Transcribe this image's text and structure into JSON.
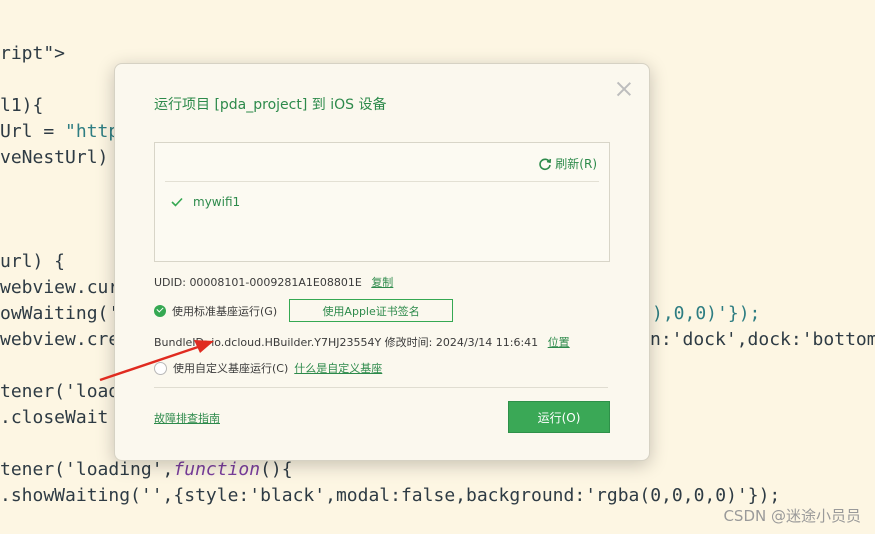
{
  "code": {
    "l1": "ript\">",
    "l2": "l1){",
    "l3a": "Url = ",
    "l3b": "\"http",
    "l4": "veNestUrl)",
    "l5": "url) {",
    "l6": "webview.cur",
    "l7a": "owWaiting('",
    "l7b": "),0,0)'});",
    "l8a": "webview.cre",
    "l8b": "n:'dock',dock:'bottom",
    "l9": "tener('load",
    "l10": ".closeWait",
    "l11a": "tener('loading',",
    "l11b": "function",
    "l11c": "(){",
    "l12": ".showWaiting('',{style:'black',modal:false,background:'rgba(0,0,0,0)'});"
  },
  "dialog": {
    "title": "运行项目 [pda_project] 到 iOS 设备",
    "refresh_label": "刷新(R)",
    "device_name": "mywifi1",
    "udid_label": "UDID: 00008101-0009281A1E08801E",
    "copy_label": "复制",
    "option_standard": "使用标准基座运行(G)",
    "apple_cert_button": "使用Apple证书签名",
    "bundle_text": "BundleID: io.dcloud.HBuilder.Y7HJ23554Y  修改时间: 2024/3/14 11:6:41",
    "location_label": "位置",
    "option_custom": "使用自定义基座运行(C)",
    "what_is_custom": "什么是自定义基座",
    "troubleshoot_link": "故障排查指南",
    "run_button": "运行(O)"
  },
  "watermark": "CSDN @迷途小员员"
}
